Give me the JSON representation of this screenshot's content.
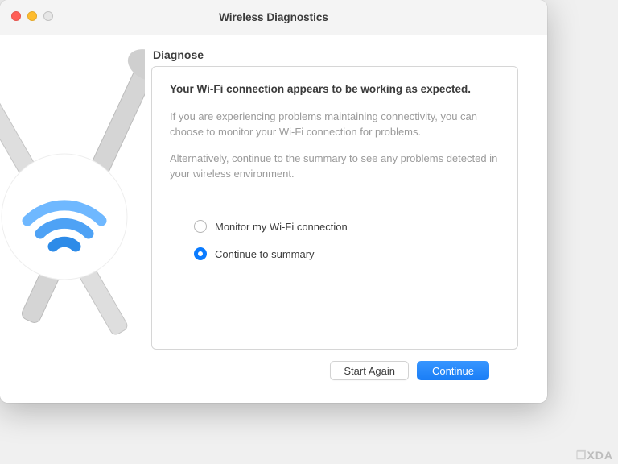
{
  "window": {
    "title": "Wireless Diagnostics"
  },
  "section": {
    "heading": "Diagnose"
  },
  "panel": {
    "status_headline": "Your Wi-Fi connection appears to be working as expected.",
    "para1": "If you are experiencing problems maintaining connectivity, you can choose to monitor your Wi-Fi connection for problems.",
    "para2": "Alternatively, continue to the summary to see any problems detected in your wireless environment."
  },
  "options": {
    "monitor": {
      "label": "Monitor my Wi-Fi connection",
      "selected": false
    },
    "continue_summary": {
      "label": "Continue to summary",
      "selected": true
    }
  },
  "buttons": {
    "start_again": "Start Again",
    "continue": "Continue"
  },
  "colors": {
    "accent": "#1a7ef6",
    "traffic_close": "#ff5f57",
    "traffic_min": "#febc2e"
  },
  "watermark": "XDA"
}
